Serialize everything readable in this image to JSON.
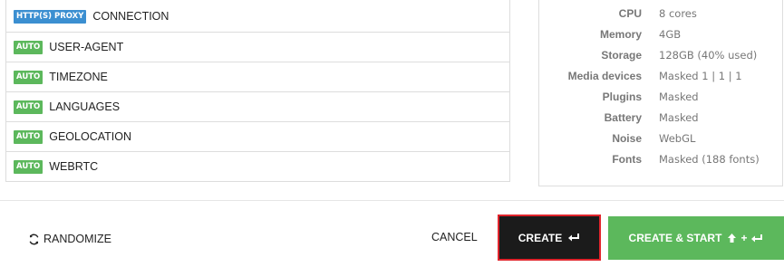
{
  "settings": [
    {
      "badge": "HTTP(S) PROXY",
      "badge_type": "proxy",
      "label": "CONNECTION"
    },
    {
      "badge": "AUTO",
      "badge_type": "auto",
      "label": "USER-AGENT"
    },
    {
      "badge": "AUTO",
      "badge_type": "auto",
      "label": "TIMEZONE"
    },
    {
      "badge": "AUTO",
      "badge_type": "auto",
      "label": "LANGUAGES"
    },
    {
      "badge": "AUTO",
      "badge_type": "auto",
      "label": "GEOLOCATION"
    },
    {
      "badge": "AUTO",
      "badge_type": "auto",
      "label": "WEBRTC"
    }
  ],
  "fingerprint": [
    {
      "label": "CPU",
      "value": "8 cores"
    },
    {
      "label": "Memory",
      "value": "4GB"
    },
    {
      "label": "Storage",
      "value": "128GB (40% used)"
    },
    {
      "label": "Media devices",
      "value": "Masked 1 | 1 | 1"
    },
    {
      "label": "Plugins",
      "value": "Masked"
    },
    {
      "label": "Battery",
      "value": "Masked"
    },
    {
      "label": "Noise",
      "value": "WebGL"
    },
    {
      "label": "Fonts",
      "value": "Masked (188 fonts)"
    }
  ],
  "footer": {
    "randomize_label": "RANDOMIZE",
    "cancel_label": "CANCEL",
    "create_label": "CREATE",
    "create_start_label": "CREATE & START",
    "shortcut_plus": "+"
  },
  "colors": {
    "proxy_badge": "#3b8fd1",
    "auto_badge": "#5cb85c",
    "create_bg": "#1b1b1b",
    "create_highlight": "#e0242c",
    "create_start_bg": "#5cb85c"
  },
  "icons": {
    "randomize": "refresh-icon",
    "create": "enter-icon",
    "create_start": "shift-enter-icon"
  }
}
